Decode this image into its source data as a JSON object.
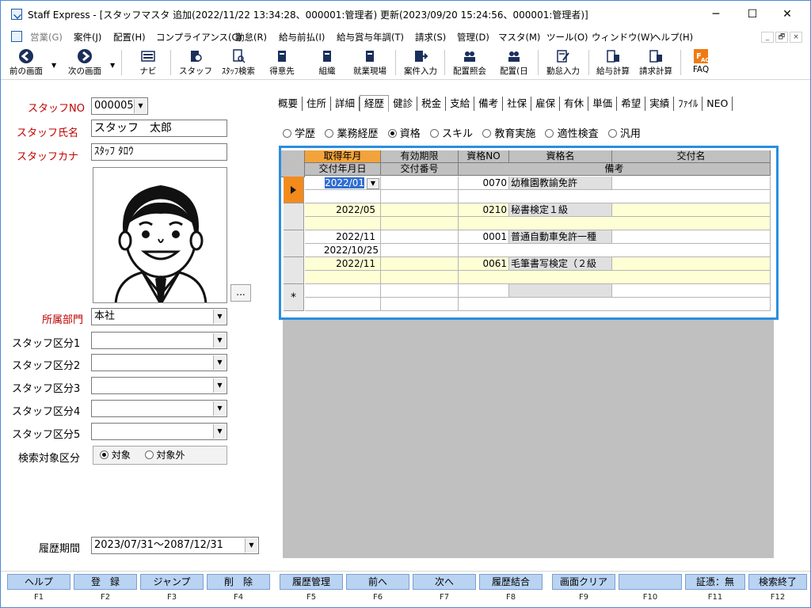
{
  "window": {
    "title": "Staff Express - [スタッフマスタ 追加(2022/11/22 13:34:28、000001:管理者) 更新(2023/09/20 15:24:56、000001:管理者)]",
    "minimize": "─",
    "maximize": "☐",
    "close": "✕"
  },
  "menu": {
    "items": [
      "営業(G)",
      "案件(J)",
      "配置(H)",
      "コンプライアンス(C)",
      "勤怠(R)",
      "給与前払(I)",
      "給与賞与年調(T)",
      "請求(S)",
      "管理(D)",
      "マスタ(M)",
      "ツール(O)",
      "ウィンドウ(W)",
      "ヘルプ(H)"
    ],
    "mdi_min": "_",
    "mdi_restore": "🗗",
    "mdi_close": "×"
  },
  "toolbar": {
    "items": [
      "前の画面",
      "次の画面",
      "ナビ",
      "スタッフ",
      "ｽﾀｯﾌ検索",
      "得意先",
      "組織",
      "就業現場",
      "案件入力",
      "配置照会",
      "配置(日",
      "勤怠入力",
      "給与計算",
      "請求計算",
      "FAQ"
    ]
  },
  "staff": {
    "no_label": "スタッフNO",
    "no_value": "000005",
    "name_label": "スタッフ氏名",
    "name_value": "スタッフ　太郎",
    "kana_label": "スタッフカナ",
    "kana_value": "ｽﾀｯﾌ ﾀﾛｳ",
    "photo_button": "...",
    "dept_label": "所属部門",
    "dept_value": "本社",
    "kubun_labels": [
      "スタッフ区分1",
      "スタッフ区分2",
      "スタッフ区分3",
      "スタッフ区分4",
      "スタッフ区分5"
    ],
    "search_label": "検索対象区分",
    "search_opt_on": "対象",
    "search_opt_off": "対象外",
    "history_label": "履歴期間",
    "history_value": "2023/07/31～2087/12/31"
  },
  "tabs": [
    "概要",
    "住所",
    "詳細",
    "経歴",
    "健診",
    "税金",
    "支給",
    "備考",
    "社保",
    "雇保",
    "有休",
    "単価",
    "希望",
    "実績",
    "ﾌｧｲﾙ",
    "NEO"
  ],
  "active_tab": "経歴",
  "type_options": [
    "学歴",
    "業務経歴",
    "資格",
    "スキル",
    "教育実施",
    "適性検査",
    "汎用"
  ],
  "selected_type": "資格",
  "grid": {
    "headers_top": [
      "取得年月",
      "有効期限",
      "資格NO",
      "資格名",
      "交付名"
    ],
    "headers_bottom": [
      "交付年月日",
      "交付番号",
      "備考"
    ],
    "rows": [
      {
        "acquired": "2022/01",
        "expiry": "",
        "no": "0070",
        "name": "幼稚園教諭免許",
        "issuer": "",
        "issue_date": "",
        "issue_no": "",
        "note": ""
      },
      {
        "acquired": "2022/05",
        "expiry": "",
        "no": "0210",
        "name": "秘書検定１級",
        "issuer": "",
        "issue_date": "",
        "issue_no": "",
        "note": ""
      },
      {
        "acquired": "2022/11",
        "expiry": "",
        "no": "0001",
        "name": "普通自動車免許一種",
        "issuer": "",
        "issue_date": "2022/10/25",
        "issue_no": "",
        "note": ""
      },
      {
        "acquired": "2022/11",
        "expiry": "",
        "no": "0061",
        "name": "毛筆書写検定（２級",
        "issuer": "",
        "issue_date": "",
        "issue_no": "",
        "note": ""
      }
    ],
    "new_row_marker": "*"
  },
  "fkeys": [
    {
      "label": "ヘルプ",
      "key": "F1"
    },
    {
      "label": "登　録",
      "key": "F2"
    },
    {
      "label": "ジャンプ",
      "key": "F3"
    },
    {
      "label": "削　除",
      "key": "F4"
    },
    {
      "label": "履歴管理",
      "key": "F5"
    },
    {
      "label": "前へ",
      "key": "F6"
    },
    {
      "label": "次へ",
      "key": "F7"
    },
    {
      "label": "履歴結合",
      "key": "F8"
    },
    {
      "label": "画面クリア",
      "key": "F9"
    },
    {
      "label": "",
      "key": "F10"
    },
    {
      "label": "証憑：無",
      "key": "F11"
    },
    {
      "label": "検索終了",
      "key": "F12"
    }
  ],
  "colors": {
    "accent_header": "#f3a33b",
    "grid_highlight": "#2a8ee0",
    "label_red": "#c00000",
    "fkey_bg": "#b9d3f2"
  }
}
